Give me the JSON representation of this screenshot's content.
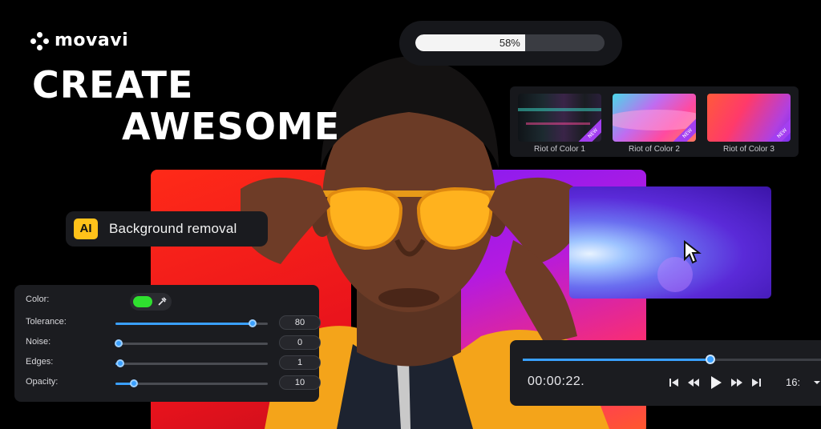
{
  "brand": {
    "name": "movavi"
  },
  "headline": {
    "line1": "CREATE",
    "line2": "AWESOME"
  },
  "export_progress": {
    "percent": 58,
    "label": "58%"
  },
  "effects": [
    {
      "label": "Riot of Color 1",
      "badge": "NEW"
    },
    {
      "label": "Riot of Color 2",
      "badge": "NEW"
    },
    {
      "label": "Riot of Color 3",
      "badge": "NEW"
    }
  ],
  "ai_feature": {
    "badge": "AI",
    "label": "Background removal"
  },
  "chroma_settings": {
    "color_label": "Color:",
    "color_value": "#2fe02f",
    "rows": [
      {
        "label": "Tolerance:",
        "value": "80",
        "level": 0.9
      },
      {
        "label": "Noise:",
        "value": "0",
        "level": 0.02
      },
      {
        "label": "Edges:",
        "value": "1",
        "level": 0.03
      },
      {
        "label": "Opacity:",
        "value": "10",
        "level": 0.12
      }
    ]
  },
  "player": {
    "timecode": "00:00:22.",
    "playhead_fraction": 0.61,
    "aspect_ratio": "16:",
    "controls": [
      "skip-start-icon",
      "rewind-icon",
      "play-icon",
      "fast-forward-icon",
      "skip-end-icon"
    ]
  },
  "colors": {
    "accent": "#3aa0ff",
    "ai_badge": "#ffc21a",
    "new_badge": "#a33ff0"
  }
}
